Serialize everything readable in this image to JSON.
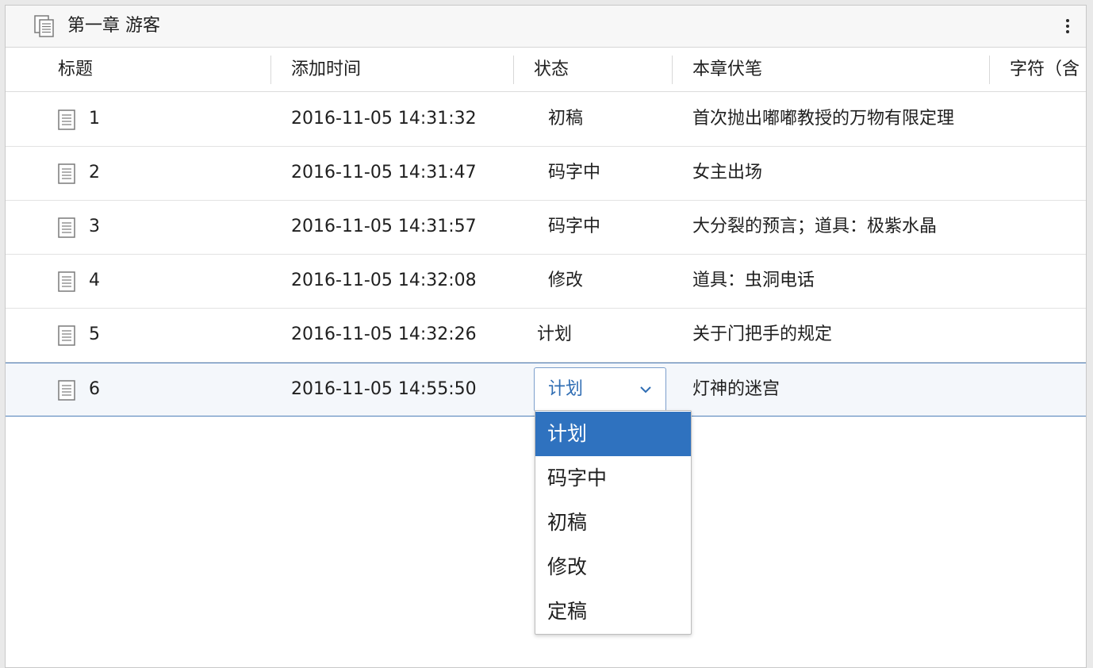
{
  "header": {
    "title": "第一章 游客",
    "icon": "doc-stack-icon",
    "menu_icon": "more-vertical-icon"
  },
  "columns": [
    "标题",
    "添加时间",
    "状态",
    "本章伏笔",
    "字符（含"
  ],
  "rows": [
    {
      "title": "1",
      "added": "2016-11-05 14:31:32",
      "status": "初稿",
      "foreshadow": "首次抛出嘟嘟教授的万物有限定理"
    },
    {
      "title": "2",
      "added": "2016-11-05 14:31:47",
      "status": "码字中",
      "foreshadow": "女主出场"
    },
    {
      "title": "3",
      "added": "2016-11-05 14:31:57",
      "status": "码字中",
      "foreshadow": "大分裂的预言；道具：极紫水晶"
    },
    {
      "title": "4",
      "added": "2016-11-05 14:32:08",
      "status": "修改",
      "foreshadow": "道具：虫洞电话"
    },
    {
      "title": "5",
      "added": "2016-11-05 14:32:26",
      "status": "计划",
      "foreshadow": "关于门把手的规定"
    },
    {
      "title": "6",
      "added": "2016-11-05 14:55:50",
      "status": "计划",
      "foreshadow": "灯神的迷宫"
    }
  ],
  "status_select": {
    "value": "计划",
    "options": [
      "计划",
      "码字中",
      "初稿",
      "修改",
      "定稿"
    ],
    "highlighted": "计划"
  },
  "colors": {
    "selection_border": "#4f7fb8",
    "select_text": "#2f6db3",
    "option_highlight": "#2f72bf"
  }
}
